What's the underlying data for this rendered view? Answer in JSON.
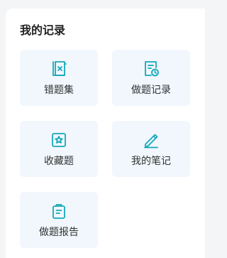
{
  "section": {
    "title": "我的记录"
  },
  "theme": {
    "accent": "#14a9b8",
    "tile_bg": "#f1f7fd"
  },
  "items": [
    {
      "label": "错题集",
      "icon": "wrong-book-icon"
    },
    {
      "label": "做题记录",
      "icon": "history-clock-icon"
    },
    {
      "label": "收藏题",
      "icon": "star-bookmark-icon"
    },
    {
      "label": "我的笔记",
      "icon": "pencil-note-icon"
    },
    {
      "label": "做题报告",
      "icon": "clipboard-report-icon"
    }
  ]
}
